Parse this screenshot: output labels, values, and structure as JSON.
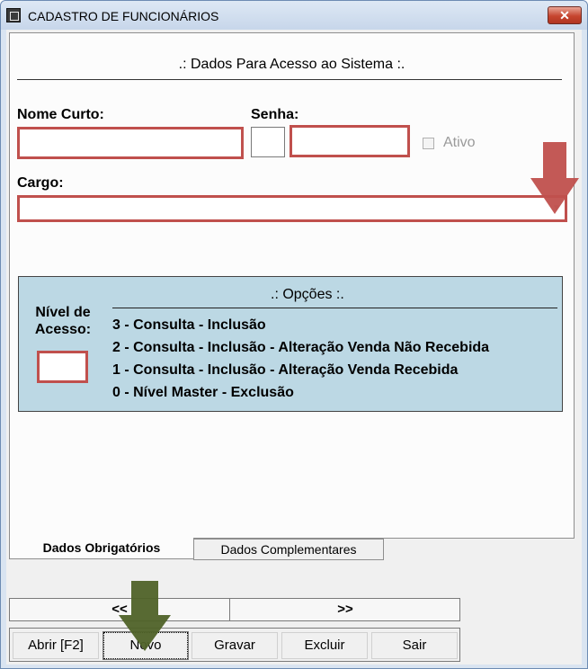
{
  "window": {
    "title": "CADASTRO DE FUNCIONÁRIOS",
    "close_glyph": "✕"
  },
  "access_section": {
    "title": ".: Dados Para Acesso ao Sistema :.",
    "nome_curto_label": "Nome Curto:",
    "nome_curto_value": "",
    "senha_label": "Senha:",
    "senha_value": "",
    "ativo_label": "Ativo",
    "ativo_checked": false,
    "cargo_label": "Cargo:",
    "cargo_value": ""
  },
  "options": {
    "title": ".: Opções :.",
    "nivel_label_line1": "Nível de",
    "nivel_label_line2": "Acesso:",
    "nivel_value": "",
    "items": [
      "3 - Consulta - Inclusão",
      "2 - Consulta - Inclusão - Alteração Venda Não Recebida",
      "1 - Consulta - Inclusão - Alteração Venda Recebida",
      "0 - Nível Master - Exclusão"
    ]
  },
  "tabs": [
    {
      "label": "Dados Obrigatórios",
      "active": true
    },
    {
      "label": "Dados Complementares",
      "active": false
    }
  ],
  "navigation": {
    "prev_label": "<<",
    "next_label": ">>"
  },
  "buttons": {
    "abrir_label": "Abrir [F2]",
    "novo_label": "Novo",
    "gravar_label": "Gravar",
    "excluir_label": "Excluir",
    "sair_label": "Sair"
  },
  "colors": {
    "field_highlight": "#c0504d",
    "options_background": "#bcd8e4",
    "annotation_red_arrow": "#c0504d",
    "annotation_green_arrow": "#4f6228"
  },
  "icons": {
    "app": "app-icon",
    "close": "close-icon",
    "dropdown": "chevron-down-icon",
    "annotation_red": "arrow-down-icon",
    "annotation_green": "arrow-down-icon"
  }
}
